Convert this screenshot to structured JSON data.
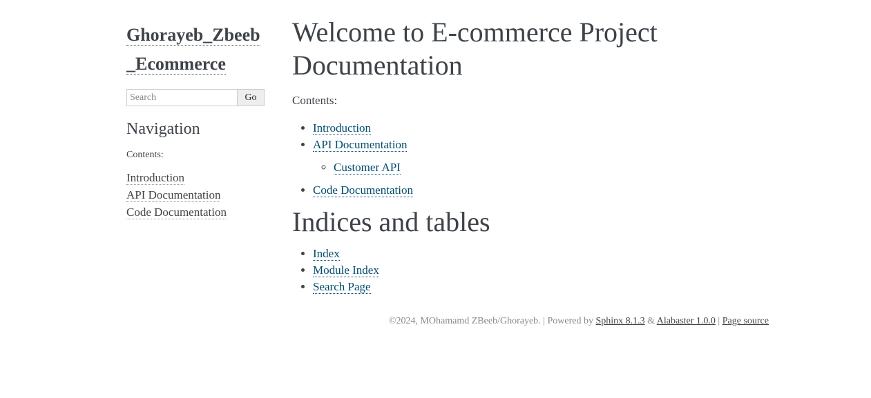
{
  "sidebar": {
    "logo": "Ghorayeb_Zbeeb_Ecommerce",
    "search": {
      "placeholder": "Search",
      "button_label": "Go"
    },
    "navigation_title": "Navigation",
    "contents_caption": "Contents:",
    "items": [
      {
        "label": "Introduction"
      },
      {
        "label": "API Documentation"
      },
      {
        "label": "Code Documentation"
      }
    ]
  },
  "main": {
    "title": "Welcome to E-commerce Project Documentation",
    "contents_caption": "Contents:",
    "toc": [
      {
        "label": "Introduction"
      },
      {
        "label": "API Documentation",
        "children": [
          {
            "label": "Customer API"
          }
        ]
      },
      {
        "label": "Code Documentation"
      }
    ],
    "indices_title": "Indices and tables",
    "indices": [
      {
        "label": "Index"
      },
      {
        "label": "Module Index"
      },
      {
        "label": "Search Page"
      }
    ]
  },
  "footer": {
    "copyright": "©2024, MOhamamd ZBeeb/Ghorayeb.",
    "powered_by_prefix": " | Powered by ",
    "sphinx_label": "Sphinx 8.1.3",
    "amp": " & ",
    "alabaster_label": "Alabaster 1.0.0",
    "sep": " | ",
    "page_source_label": "Page source"
  },
  "colors": {
    "text": "#3e4349",
    "link": "#004b6b",
    "footer_text": "#888888"
  }
}
